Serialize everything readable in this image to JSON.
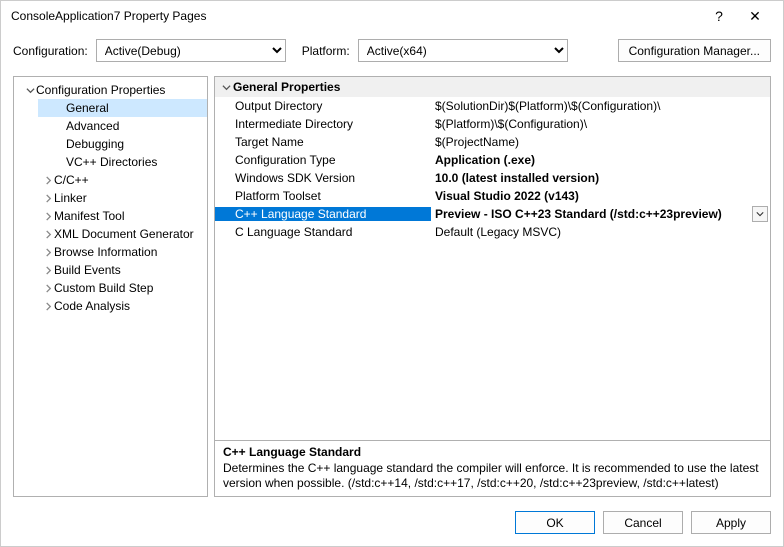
{
  "window": {
    "title": "ConsoleApplication7 Property Pages",
    "help": "?",
    "close": "✕"
  },
  "top": {
    "config_label": "Configuration:",
    "config_value": "Active(Debug)",
    "platform_label": "Platform:",
    "platform_value": "Active(x64)",
    "config_mgr": "Configuration Manager..."
  },
  "tree": {
    "root": "Configuration Properties",
    "items": [
      {
        "label": "General",
        "selected": true,
        "expandable": false,
        "indent": true
      },
      {
        "label": "Advanced",
        "expandable": false,
        "indent": true
      },
      {
        "label": "Debugging",
        "expandable": false,
        "indent": true
      },
      {
        "label": "VC++ Directories",
        "expandable": false,
        "indent": true
      },
      {
        "label": "C/C++",
        "expandable": true
      },
      {
        "label": "Linker",
        "expandable": true
      },
      {
        "label": "Manifest Tool",
        "expandable": true
      },
      {
        "label": "XML Document Generator",
        "expandable": true
      },
      {
        "label": "Browse Information",
        "expandable": true
      },
      {
        "label": "Build Events",
        "expandable": true
      },
      {
        "label": "Custom Build Step",
        "expandable": true
      },
      {
        "label": "Code Analysis",
        "expandable": true
      }
    ]
  },
  "group": {
    "name": "General Properties"
  },
  "properties": [
    {
      "name": "Output Directory",
      "value": "$(SolutionDir)$(Platform)\\$(Configuration)\\",
      "bold": false
    },
    {
      "name": "Intermediate Directory",
      "value": "$(Platform)\\$(Configuration)\\",
      "bold": false
    },
    {
      "name": "Target Name",
      "value": "$(ProjectName)",
      "bold": false
    },
    {
      "name": "Configuration Type",
      "value": "Application (.exe)",
      "bold": true
    },
    {
      "name": "Windows SDK Version",
      "value": "10.0 (latest installed version)",
      "bold": true
    },
    {
      "name": "Platform Toolset",
      "value": "Visual Studio 2022 (v143)",
      "bold": true
    },
    {
      "name": "C++ Language Standard",
      "value": "Preview - ISO C++23 Standard (/std:c++23preview)",
      "bold": true,
      "selected": true,
      "dropdown": true
    },
    {
      "name": "C Language Standard",
      "value": "Default (Legacy MSVC)",
      "bold": false
    }
  ],
  "description": {
    "title": "C++ Language Standard",
    "body": "Determines the C++ language standard the compiler will enforce. It is recommended to use the latest version when possible.  (/std:c++14, /std:c++17, /std:c++20, /std:c++23preview, /std:c++latest)"
  },
  "buttons": {
    "ok": "OK",
    "cancel": "Cancel",
    "apply": "Apply"
  }
}
